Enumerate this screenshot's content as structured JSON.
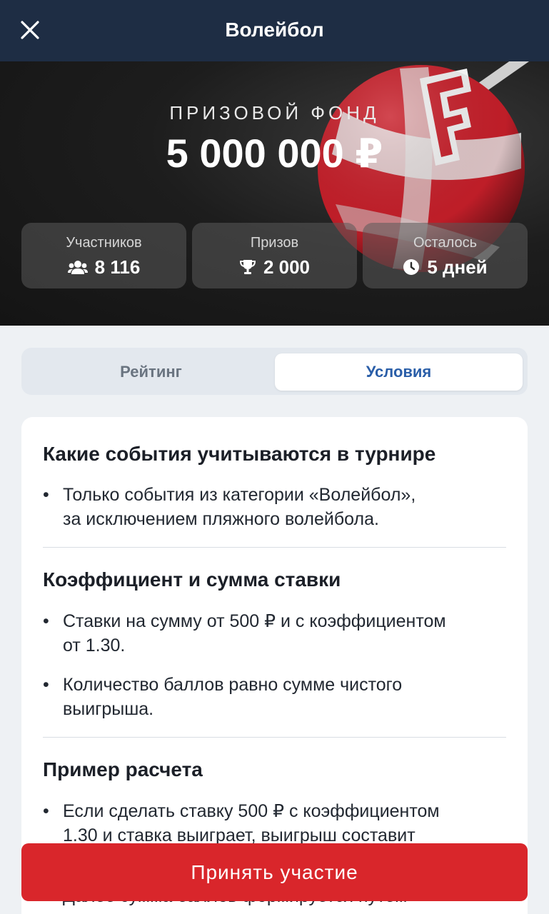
{
  "header": {
    "title": "Волейбол"
  },
  "hero": {
    "prize_label": "ПРИЗОВОЙ ФОНД",
    "prize_value": "5 000 000 ₽",
    "stats": [
      {
        "label": "Участников",
        "value": "8 116",
        "icon": "users-icon"
      },
      {
        "label": "Призов",
        "value": "2 000",
        "icon": "trophy-icon"
      },
      {
        "label": "Осталось",
        "value": "5 дней",
        "icon": "clock-icon"
      }
    ]
  },
  "tabs": [
    {
      "label": "Рейтинг",
      "active": false
    },
    {
      "label": "Условия",
      "active": true
    }
  ],
  "conditions": [
    {
      "title": "Какие события учитываются в турнире",
      "items": [
        [
          "Только события из категории «Волейбол»,",
          "за исключением пляжного волейбола."
        ]
      ]
    },
    {
      "title": "Коэффициент и сумма ставки",
      "items": [
        [
          "Ставки на сумму от 500 ₽ и с коэффициентом",
          "от 1.30."
        ],
        [
          "Количество баллов равно сумме чистого",
          "выигрыша."
        ]
      ]
    },
    {
      "title": "Пример расчета",
      "items": [
        [
          "Если сделать ставку 500 ₽ с коэффициентом",
          "1.30 и ставка выиграет, выигрыш составит"
        ],
        [
          "Далее сумма баллов формируется путем"
        ]
      ]
    }
  ],
  "cta": {
    "label": "Принять участие"
  },
  "colors": {
    "header_bg": "#1e2d44",
    "accent": "#2a5ea8",
    "cta_bg": "#d9262b"
  }
}
